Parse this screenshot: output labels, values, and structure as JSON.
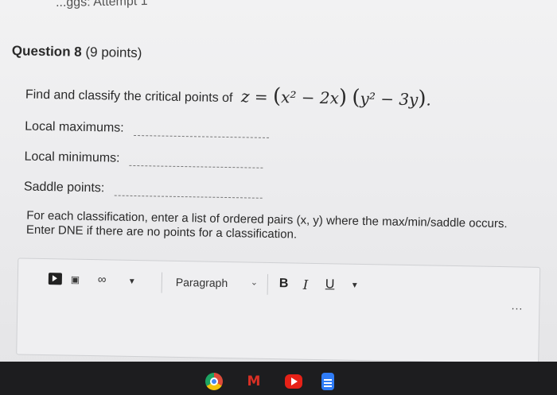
{
  "header": {
    "attempt_text": "...ggs: Attempt 1"
  },
  "question": {
    "number_label": "Question 8",
    "points_label": "(9 points)",
    "prompt": "Find and classify the critical points of",
    "equation": {
      "lhs": "z =",
      "term1": "x² − 2x",
      "term2": "y² − 3y"
    },
    "fields": [
      {
        "label": "Local maximums:",
        "value": ""
      },
      {
        "label": "Local minimums:",
        "value": ""
      },
      {
        "label": "Saddle points:",
        "value": ""
      }
    ],
    "instructions": "For each classification, enter a list of ordered pairs (x, y) where the max/min/saddle occurs. Enter DNE if there are no points for a classification."
  },
  "editor": {
    "toolbar": {
      "style_select": "Paragraph",
      "bold": "B",
      "italic": "I",
      "underline": "U",
      "more": "..."
    }
  },
  "taskbar": {
    "apps": [
      "chrome-icon",
      "gmail-icon",
      "youtube-icon",
      "docs-icon"
    ],
    "gmail_glyph": "M"
  }
}
